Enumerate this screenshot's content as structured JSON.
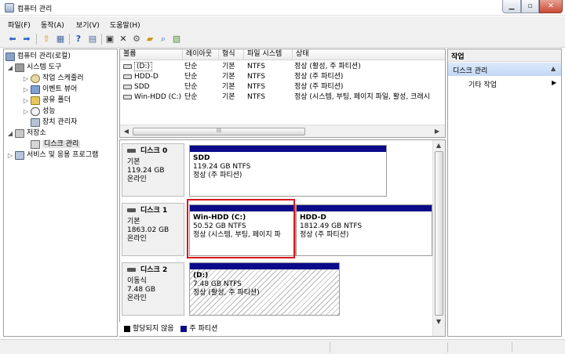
{
  "window": {
    "title": "컴퓨터 관리"
  },
  "menu": [
    "파일(F)",
    "동작(A)",
    "보기(V)",
    "도움말(H)"
  ],
  "toolbar_icons": [
    "back-arrow-icon",
    "forward-arrow-icon",
    "up-folder-icon",
    "show-hide-tree-icon",
    "help-icon",
    "properties-icon",
    "refresh-icon",
    "delete-icon",
    "settings-icon",
    "open-icon",
    "search-icon",
    "help-topics-icon"
  ],
  "tree": {
    "root": "컴퓨터 관리(로컬)",
    "system_tools": "시스템 도구",
    "task_scheduler": "작업 스케줄러",
    "event_viewer": "이벤트 뷰어",
    "shared_folders": "공유 폴더",
    "performance": "성능",
    "device_manager": "장치 관리자",
    "storage": "저장소",
    "disk_management": "디스크 관리",
    "services_apps": "서비스 및 응용 프로그램"
  },
  "volume_list": {
    "columns": [
      "볼륨",
      "레이아웃",
      "형식",
      "파일 시스템",
      "상태"
    ],
    "rows": [
      [
        "(D:)",
        "단순",
        "기본",
        "NTFS",
        "정상 (활성, 주 파티션)"
      ],
      [
        "HDD-D",
        "단순",
        "기본",
        "NTFS",
        "정상 (주 파티션)"
      ],
      [
        "SDD",
        "단순",
        "기본",
        "NTFS",
        "정상 (주 파티션)"
      ],
      [
        "Win-HDD (C:)",
        "단순",
        "기본",
        "NTFS",
        "정상 (시스템, 부팅, 페이지 파일, 활성, 크래시 "
      ]
    ],
    "scroll_thumb": "III"
  },
  "disks": [
    {
      "name": "디스크 0",
      "type": "기본",
      "size": "119.24 GB",
      "status": "온라인",
      "partitions": [
        {
          "name": "SDD",
          "size": "119.24 GB NTFS",
          "status": "정상 (주 파티션)"
        }
      ]
    },
    {
      "name": "디스크 1",
      "type": "기본",
      "size": "1863.02 GB",
      "status": "온라인",
      "partitions": [
        {
          "name": "Win-HDD  (C:)",
          "size": "50.52 GB NTFS",
          "status": "정상 (시스템, 부팅, 페이지 파"
        },
        {
          "name": "HDD-D",
          "size": "1812.49 GB NTFS",
          "status": "정상 (주 파티션)"
        }
      ]
    },
    {
      "name": "디스크 2",
      "type": "이동식",
      "size": "7.48 GB",
      "status": "온라인",
      "partitions": [
        {
          "name": "(D:)",
          "size": "7.48 GB NTFS",
          "status": "정상 (활성, 주 파티션)"
        }
      ]
    }
  ],
  "legend": {
    "unallocated": "할당되지 않음",
    "primary": "주 파티션",
    "unallocated_color": "#000000",
    "primary_color": "#0b0b8a"
  },
  "actions": {
    "header": "작업",
    "section": "디스크 관리",
    "more": "기타 작업"
  }
}
